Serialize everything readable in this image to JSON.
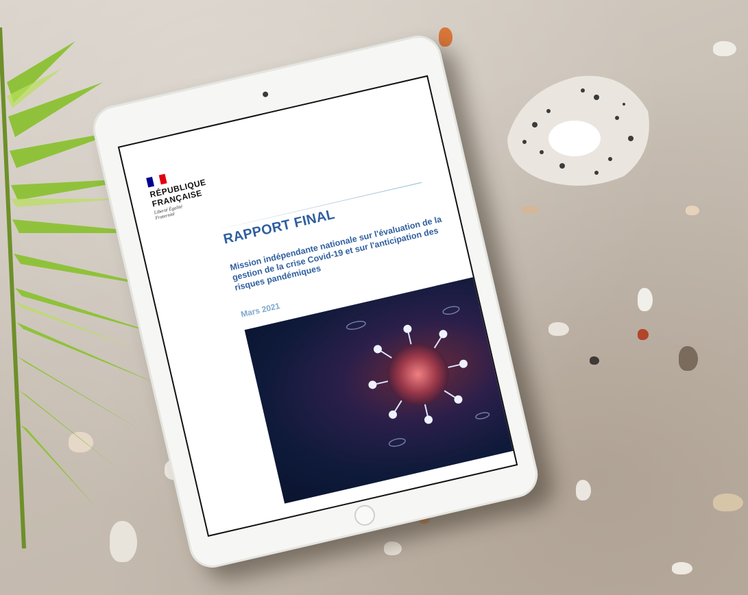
{
  "document": {
    "logo": {
      "line1": "RÉPUBLIQUE",
      "line2": "FRANÇAISE",
      "motto": "Liberté Égalité Fraternité"
    },
    "title": "RAPPORT FINAL",
    "subtitle": "Mission indépendante nationale sur l'évaluation de la gestion de la crise Covid-19 et sur l'anticipation des risques pandémiques",
    "date": "Mars 2021"
  },
  "colors": {
    "title_blue": "#2f5f9e",
    "date_blue": "#7fa6cf",
    "flag_blue": "#000091",
    "flag_white": "#ffffff",
    "flag_red": "#e1000f",
    "cover_dark": "#0f1a3a"
  },
  "objects": {
    "virus_icon": "virus-illustration",
    "shell_icon": "seashell",
    "frond_icon": "palm-frond"
  }
}
